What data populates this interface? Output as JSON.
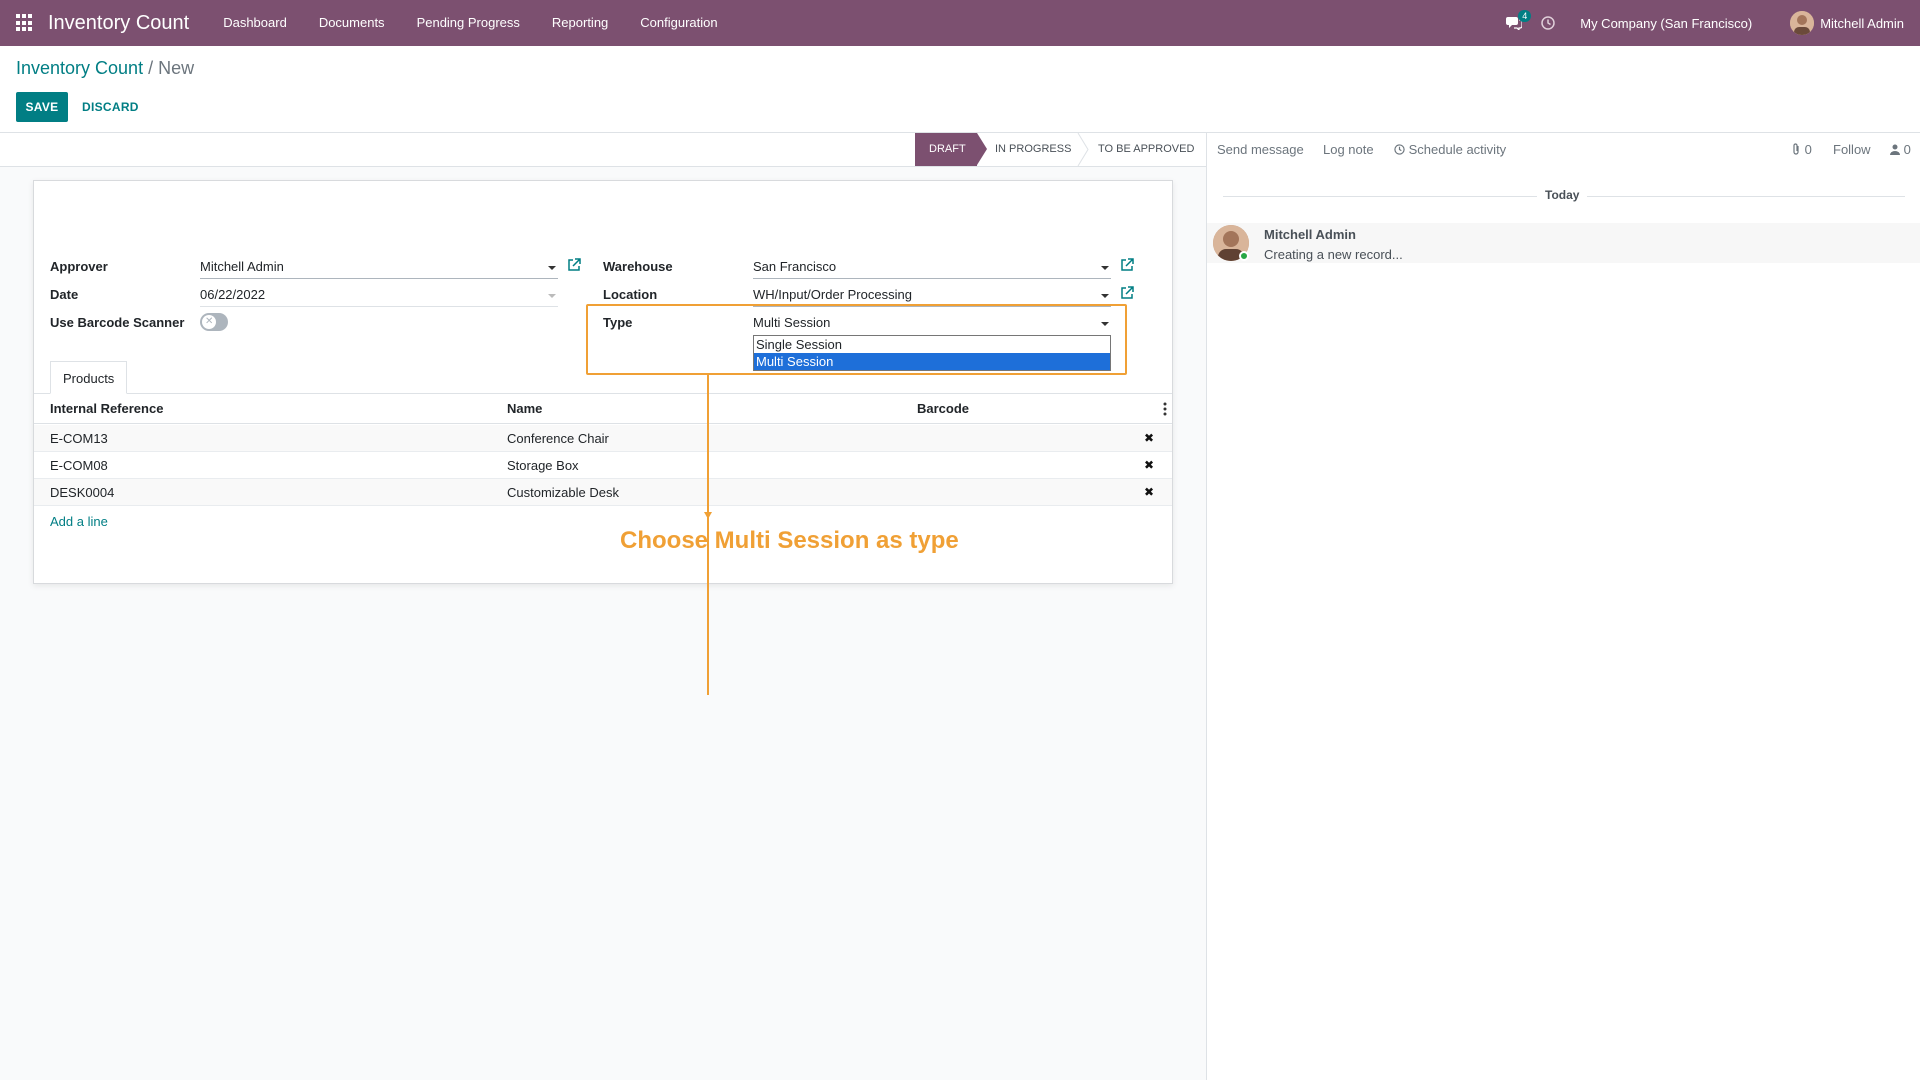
{
  "navbar": {
    "app_title": "Inventory Count",
    "menu": [
      "Dashboard",
      "Documents",
      "Pending Progress",
      "Reporting",
      "Configuration"
    ],
    "chat_count": "4",
    "company": "My Company (San Francisco)",
    "user": "Mitchell Admin",
    "color": "#7c5070"
  },
  "breadcrumb": {
    "parent": "Inventory Count",
    "separator": "/",
    "current": "New"
  },
  "toolbar": {
    "save_label": "SAVE",
    "discard_label": "DISCARD"
  },
  "statusbar": {
    "stages": [
      "DRAFT",
      "IN PROGRESS",
      "TO BE APPROVED"
    ],
    "active": "DRAFT"
  },
  "form": {
    "approver_label": "Approver",
    "approver_value": "Mitchell Admin",
    "date_label": "Date",
    "date_value": "06/22/2022",
    "barcode_label": "Use Barcode Scanner",
    "barcode_enabled": false,
    "warehouse_label": "Warehouse",
    "warehouse_value": "San Francisco",
    "location_label": "Location",
    "location_value": "WH/Input/Order Processing",
    "type_label": "Type",
    "type_value": "Multi Session",
    "type_options": [
      "Single Session",
      "Multi Session"
    ],
    "type_selected": "Multi Session"
  },
  "products": {
    "tab_label": "Products",
    "columns": [
      "Internal Reference",
      "Name",
      "Barcode"
    ],
    "rows": [
      {
        "ref": "E-COM13",
        "name": "Conference Chair",
        "barcode": ""
      },
      {
        "ref": "E-COM08",
        "name": "Storage Box",
        "barcode": ""
      },
      {
        "ref": "DESK0004",
        "name": "Customizable Desk",
        "barcode": ""
      }
    ],
    "add_line": "Add a line"
  },
  "annotation": {
    "text": "Choose Multi Session as type",
    "color": "#f0a035"
  },
  "chatter": {
    "send_message": "Send message",
    "log_note": "Log note",
    "schedule_activity": "Schedule activity",
    "attachments": "0",
    "follow": "Follow",
    "followers": "0",
    "today": "Today",
    "message_author": "Mitchell Admin",
    "message_body": "Creating a new record..."
  }
}
